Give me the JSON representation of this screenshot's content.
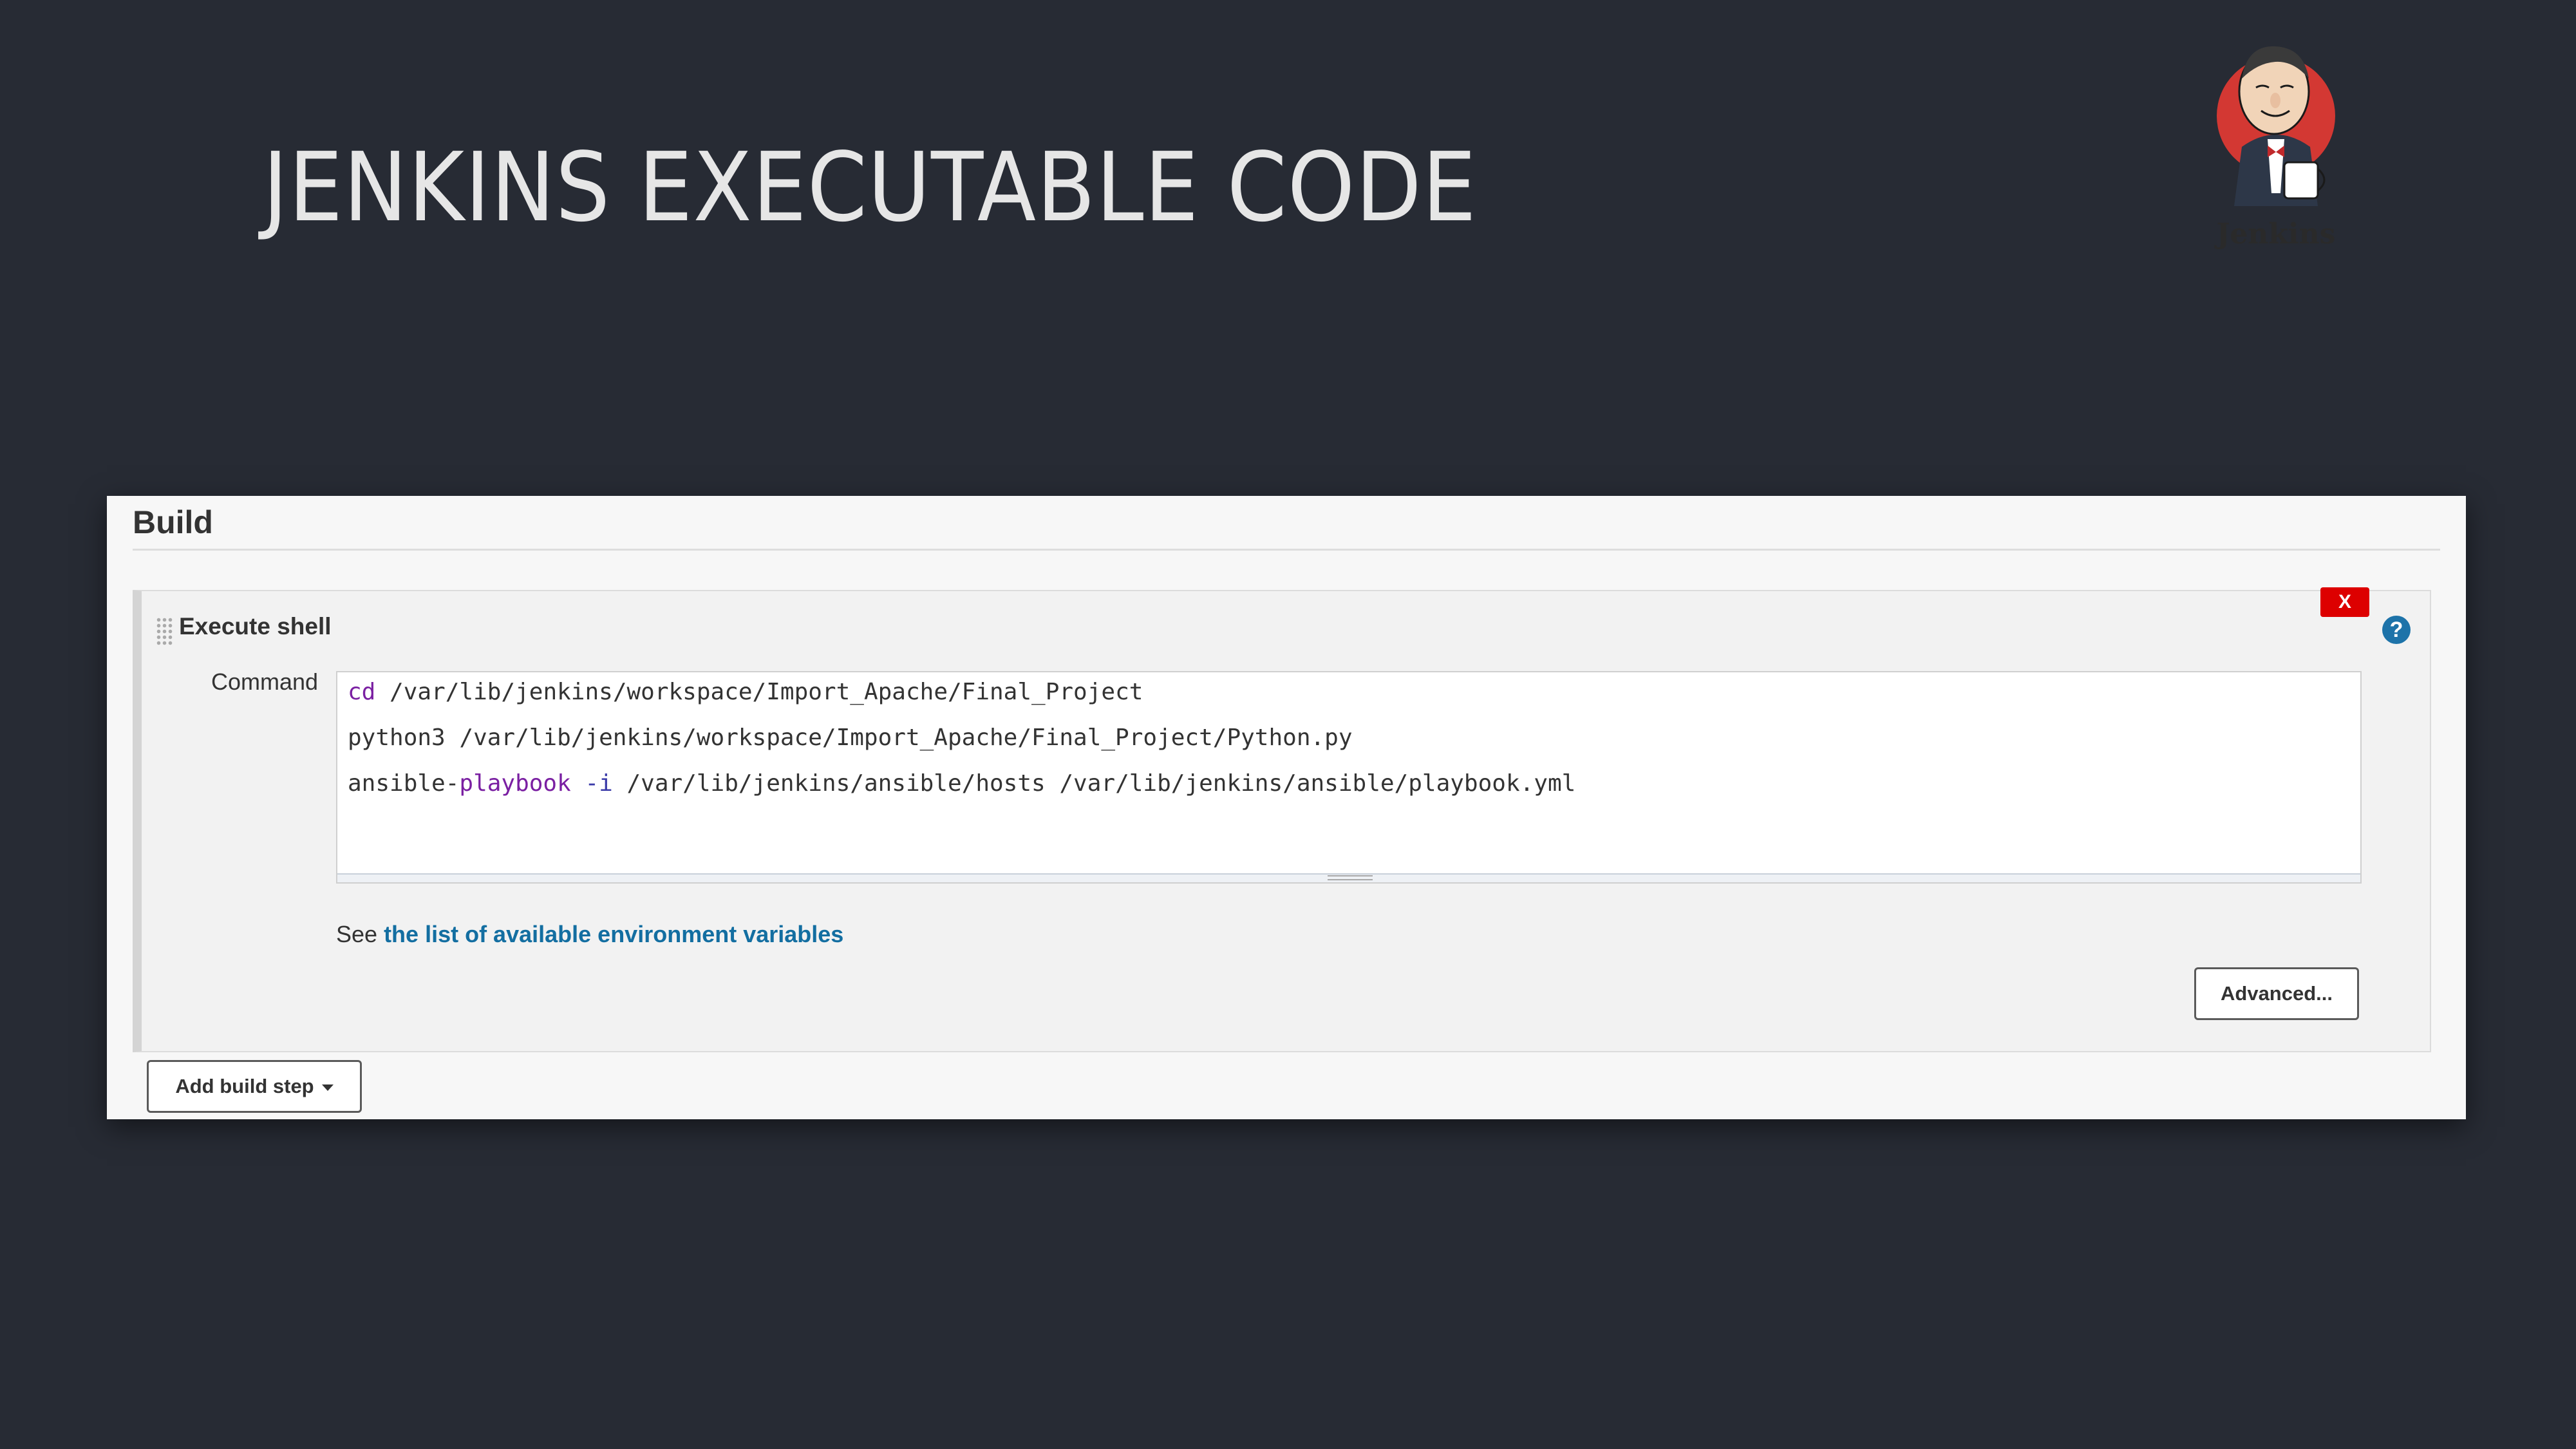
{
  "slide": {
    "title": "JENKINS EXECUTABLE CODE",
    "logo_text": "Jenkins"
  },
  "build": {
    "section_title": "Build",
    "step": {
      "title": "Execute shell",
      "delete_label": "X",
      "help_label": "?",
      "command_label": "Command",
      "command_lines": [
        {
          "kw": "cd",
          "rest": " /var/lib/jenkins/workspace/Import_Apache/Final_Project"
        },
        {
          "plain": "python3 /var/lib/jenkins/workspace/Import_Apache/Final_Project/Python.py"
        },
        {
          "a": "ansible-",
          "kw": "playbook",
          "op": " -i",
          "rest": " /var/lib/jenkins/ansible/hosts /var/lib/jenkins/ansible/playbook.yml"
        }
      ],
      "env_prefix": "See ",
      "env_link": "the list of available environment variables",
      "advanced_label": "Advanced..."
    },
    "add_step_label": "Add build step"
  },
  "colors": {
    "background": "#272b34",
    "delete": "#dd0000",
    "help": "#1d73a9",
    "link": "#136ea1",
    "keyword": "#7a1fa2"
  },
  "icons": [
    "jenkins-logo",
    "drag-handle-icon",
    "help-icon",
    "caret-down-icon"
  ]
}
